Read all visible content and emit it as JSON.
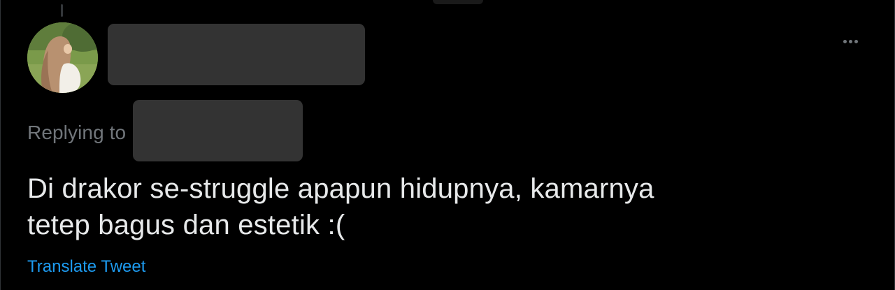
{
  "tweet": {
    "replying_label": "Replying to",
    "text_lines": [
      "Di drakor se-struggle apapun hidupnya, kamarnya",
      "tetep bagus dan estetik :("
    ],
    "translate_label": "Translate Tweet",
    "more_icon": "more-horizontal-icon"
  },
  "colors": {
    "background": "#000000",
    "primary_text": "#e7e9ea",
    "secondary_text": "#71767b",
    "link": "#1d9bf0",
    "redaction": "#333333"
  }
}
